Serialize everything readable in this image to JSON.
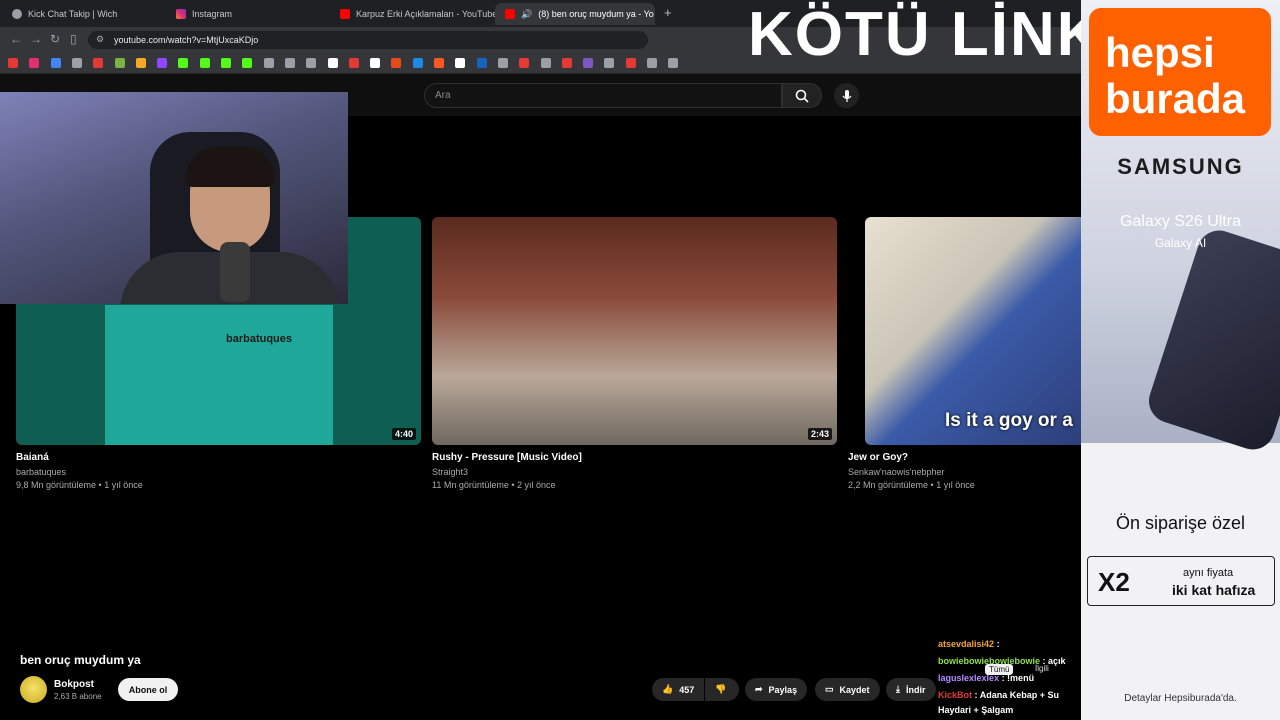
{
  "tabs": [
    {
      "label": "Kick Chat Takip | Wich",
      "color": "#9aa0a6"
    },
    {
      "label": "Instagram",
      "color": "#e1306c"
    },
    {
      "label": "Karpuz Erki Açıklamaları - YouTube",
      "color": "#ff0000"
    },
    {
      "label": "(8) ben oruç muydum ya - Yo",
      "color": "#ff0000"
    }
  ],
  "address": {
    "url": "youtube.com/watch?v=MtjUxcaKDjo"
  },
  "search": {
    "placeholder": "Ara"
  },
  "videos": [
    {
      "title": "Baianá",
      "channel": "barbatuques",
      "meta": "9,8 Mn görüntüleme • 1 yıl önce",
      "duration": "4:40",
      "thumb_text": "barbatuques"
    },
    {
      "title": "Rushy - Pressure [Music Video]",
      "channel": "Straight3",
      "meta": "11 Mn görüntüleme • 2 yıl önce",
      "duration": "2:43"
    },
    {
      "title": "Jew or Goy?",
      "channel": "Senkaw'naowis'nebpher",
      "meta": "2,2 Mn görüntüleme • 1 yıl önce",
      "thumb_text": "Is it a goy or a"
    }
  ],
  "player": {
    "title": "ben oruç muydum ya",
    "channel": "Bokpost",
    "subs": "2,63 B abone",
    "subscribe_label": "Abone ol",
    "likes": "457",
    "share_label": "Paylaş",
    "save_label": "Kaydet",
    "download_label": "İndir"
  },
  "chat": [
    {
      "user": "atsevdalisi42",
      "text": ":",
      "color": "#f2a33a"
    },
    {
      "user": "bowiebowiebowiebowie",
      "text": ": açık",
      "color": "#8ee04c"
    },
    {
      "user": "laguslexlexlex",
      "text": ": !menü",
      "color": "#b68cff"
    },
    {
      "user": "KickBot",
      "text": ": Adana Kebap + Su",
      "color": "#e53935"
    },
    {
      "user": "",
      "text": "Haydari + Şalgam",
      "color": "#ffffff"
    }
  ],
  "chat_tabs": {
    "all": "Tümü",
    "related": "İlgili"
  },
  "overlay": {
    "banner": "KÖTÜ LİNK GÜNÜ"
  },
  "ad": {
    "brand": "hepsi burada",
    "samsung": "SAMSUNG",
    "product": "Galaxy S26 Ultra",
    "ai": "Galaxy AI",
    "preorder": "Ön siparişe özel",
    "x2": "X2",
    "line1": "aynı fiyata",
    "line2": "iki kat hafıza",
    "details": "Detaylar Hepsiburada'da."
  }
}
